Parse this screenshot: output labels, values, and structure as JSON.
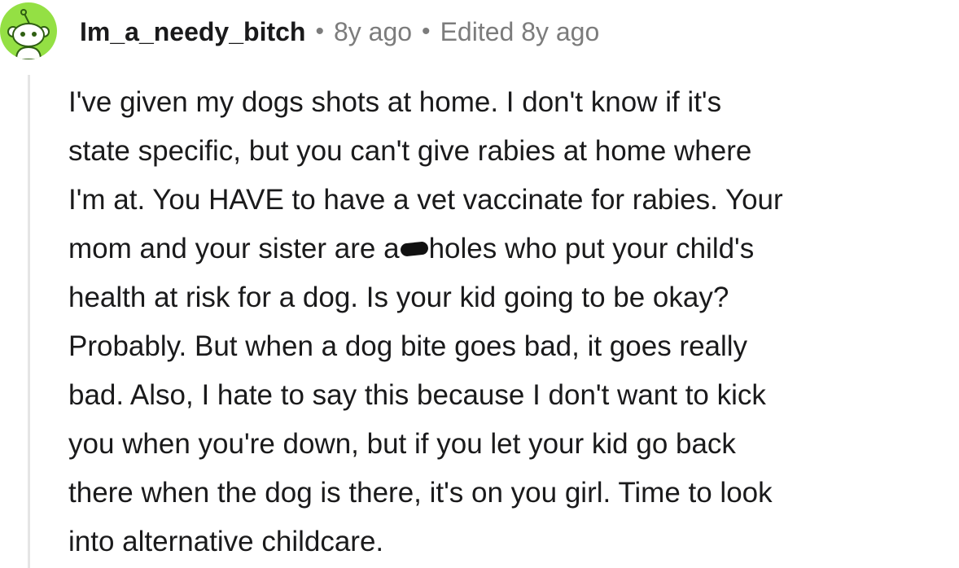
{
  "comment": {
    "author": "Im_a_needy_bitch",
    "separator": "•",
    "posted_ago": "8y ago",
    "edited_label": "Edited 8y ago",
    "avatar_color": "#94e044",
    "body_lines": [
      "I've given my dogs shots at home. I don't know if it's",
      "state specific, but you can't give rabies at home where",
      "I'm at. You HAVE to have a vet vaccinate for rabies. Your",
      {
        "before_censor": "mom and your sister are a",
        "after_censor": "holes who put your child's"
      },
      "health at risk for a dog. Is your kid going to be okay?",
      "Probably. But when a dog bite goes bad, it goes really",
      "bad. Also, I hate to say this because I don't want to kick",
      "you when you're down, but if you let your kid go back",
      "there when the dog is there, it's on you girl. Time to look",
      "into alternative childcare."
    ]
  }
}
